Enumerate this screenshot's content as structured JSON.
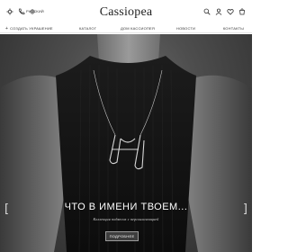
{
  "header": {
    "logo_text": "Cassiopea",
    "language": "РУССКИЙ",
    "icons": [
      "gear-icon",
      "phone-icon",
      "globe-icon",
      "search-icon",
      "user-icon",
      "heart-icon",
      "cart-icon"
    ]
  },
  "nav": {
    "create_label": "СОЗДАТЬ УКРАШЕНИЕ",
    "catalog_label": "КАТАЛОГ",
    "cassiopeia_label": "ДОМ КАССИОПЕЯ",
    "news_label": "НОВОСТИ",
    "contacts_label": "КОНТАКТЫ"
  },
  "hero": {
    "title": "ЧТО В ИМЕНИ ТВОЕМ...",
    "subtitle": "Коллекция подвесок с персонализацией",
    "button_label": "ПОДРОБНЕЕ",
    "prev_arrow": "[",
    "next_arrow": "]"
  },
  "colors": {
    "header_bg": "#ffffff",
    "text_dark": "#222222",
    "hero_bg": "#3a3a3a",
    "sweater": "#141414",
    "skin": "#8a8a8a"
  }
}
